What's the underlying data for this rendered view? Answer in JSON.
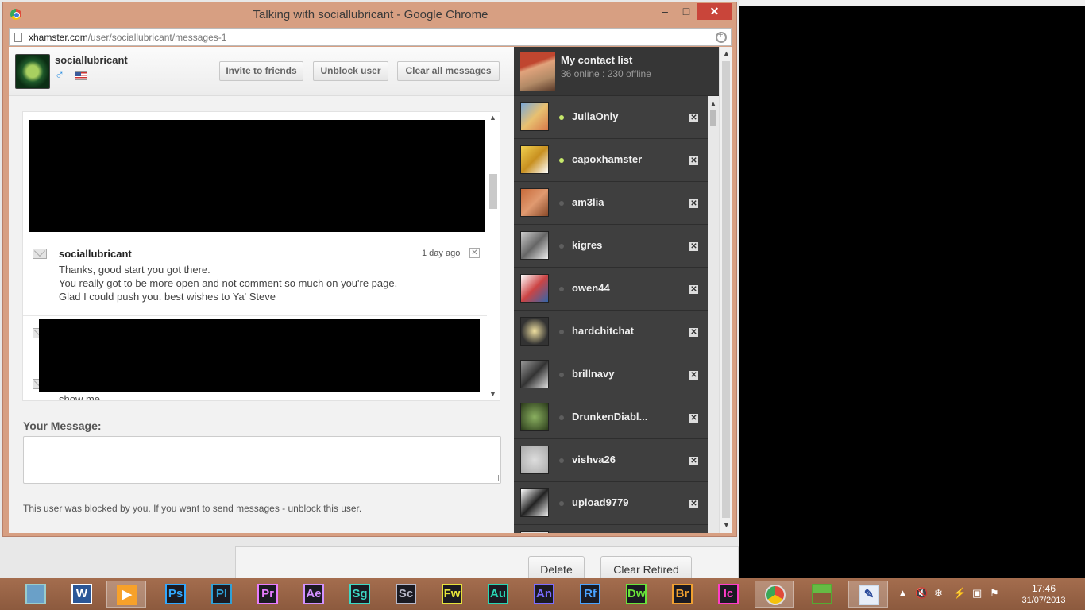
{
  "browser": {
    "window_title": "Talking with sociallubricant - Google Chrome",
    "url_host": "xhamster.com",
    "url_path": "/user/sociallubricant/messages-1",
    "minimize_glyph": "–",
    "maximize_glyph": "□",
    "close_glyph": "✕"
  },
  "conversation": {
    "username": "sociallubricant",
    "gender_glyph": "♂",
    "buttons": {
      "invite": "Invite to friends",
      "unblock": "Unblock user",
      "clear_all": "Clear all messages"
    },
    "messages": [
      {
        "sender": "sociallubricant",
        "time": "1 day ago",
        "lines": [
          "Thanks, good start you got there.",
          "You really got to be more open and not comment so much on you're page.",
          "Glad I could push you. best wishes to Ya' Steve"
        ]
      },
      {
        "text": "show me"
      }
    ],
    "your_message_label": "Your Message:",
    "blocked_note": "This user was blocked by you. If you want to send messages - unblock this user."
  },
  "contacts": {
    "title": "My contact list",
    "status": "36 online : 230 offline",
    "list": [
      {
        "name": "JuliaOnly",
        "online": true
      },
      {
        "name": "capoxhamster",
        "online": true
      },
      {
        "name": "am3lia",
        "online": false
      },
      {
        "name": "kigres",
        "online": false
      },
      {
        "name": "owen44",
        "online": false
      },
      {
        "name": "hardchitchat",
        "online": false
      },
      {
        "name": "brillnavy",
        "online": false
      },
      {
        "name": "DrunkenDiabl...",
        "online": false
      },
      {
        "name": "vishva26",
        "online": false
      },
      {
        "name": "upload9779",
        "online": false
      }
    ]
  },
  "background_app": {
    "delete_label": "Delete",
    "clear_retired_label": "Clear Retired"
  },
  "taskbar": {
    "apps": [
      {
        "label": "Ps",
        "color": "#31a8ff"
      },
      {
        "label": "Pl",
        "color": "#2fa1d8"
      },
      {
        "label": "Pr",
        "color": "#e77cff"
      },
      {
        "label": "Ae",
        "color": "#d291ff"
      },
      {
        "label": "Sg",
        "color": "#3dd9c5"
      },
      {
        "label": "Sc",
        "color": "#b8b8c8"
      },
      {
        "label": "Fw",
        "color": "#e6e23a"
      },
      {
        "label": "Au",
        "color": "#28d5b3"
      },
      {
        "label": "An",
        "color": "#7a6cff"
      },
      {
        "label": "Rf",
        "color": "#4aa3ff"
      },
      {
        "label": "Dw",
        "color": "#6ae33a"
      },
      {
        "label": "Br",
        "color": "#f0a030"
      },
      {
        "label": "Ic",
        "color": "#ff3cc8"
      }
    ],
    "time": "17:46",
    "date": "31/07/2013"
  }
}
